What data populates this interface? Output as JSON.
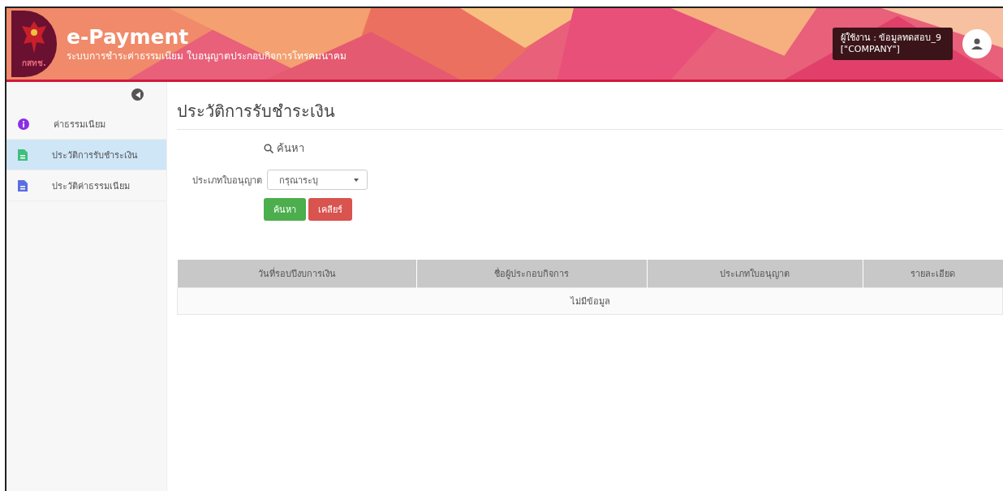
{
  "header": {
    "logo_text": "กสทช.",
    "title": "e-Payment",
    "subtitle": "ระบบการชำระค่าธรรมเนียม ใบอนุญาตประกอบกิจการโทรคมนาคม",
    "user": {
      "line1": "ผู้ใช้งาน : ข้อมูลทดสอบ_9",
      "line2": "[\"COMPANY\"]"
    }
  },
  "sidebar": {
    "items": [
      {
        "label": "ค่าธรรมเนียม",
        "kind": "info",
        "color": "#8b2ee6",
        "selected": false
      },
      {
        "label": "ประวัติการรับชำระเงิน",
        "kind": "document",
        "color": "#3fbf7f",
        "selected": true
      },
      {
        "label": "ประวัติค่าธรรมเนียม",
        "kind": "document",
        "color": "#5b6ee1",
        "selected": false
      }
    ]
  },
  "page": {
    "title": "ประวัติการรับชำระเงิน",
    "search_heading": "ค้นหา",
    "filter": {
      "label": "ประเภทใบอนุญาต",
      "value": "กรุณาระบุ"
    },
    "buttons": [
      {
        "label": "ค้นหา",
        "kind": "primary"
      },
      {
        "label": "เคลียร์",
        "kind": "danger"
      }
    ]
  },
  "table": {
    "columns": [
      "วันที่รอบปีงบการเงิน",
      "ชื่อผู้ประกอบกิจการ",
      "ประเภทใบอนุญาต",
      "รายละเอียด"
    ],
    "empty_message": "ไม่มีข้อมูล"
  }
}
